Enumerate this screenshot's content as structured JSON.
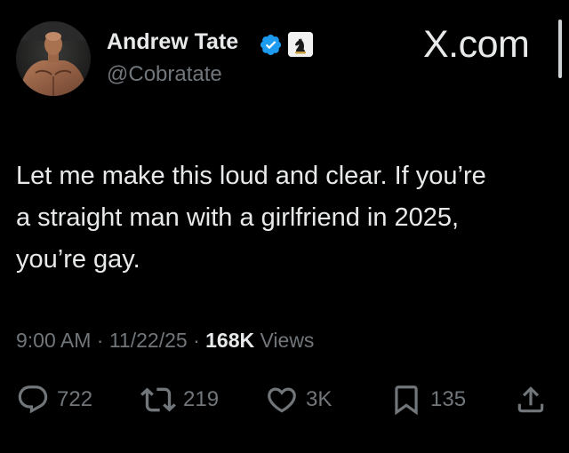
{
  "author": {
    "display_name": "Andrew Tate",
    "handle": "@Cobratate",
    "verified_icon": "verified-badge-icon",
    "affiliate_icon": "chess-knight-icon"
  },
  "brand": "X.com",
  "tweet": {
    "lines": [
      "Let me make this loud and clear. If you’re",
      "a straight man with a girlfriend in 2025,",
      "you’re gay."
    ]
  },
  "meta": {
    "time": "9:00 AM",
    "sep1": "·",
    "date": "11/22/25",
    "sep2": "·",
    "views_count": "168K",
    "views_label": "Views"
  },
  "actions": {
    "replies": "722",
    "reposts": "219",
    "likes": "3K",
    "bookmarks": "135"
  },
  "colors": {
    "background": "#000000",
    "text_primary": "#e7e9ea",
    "text_secondary": "#71767b",
    "verified_blue": "#1d9bf0"
  }
}
